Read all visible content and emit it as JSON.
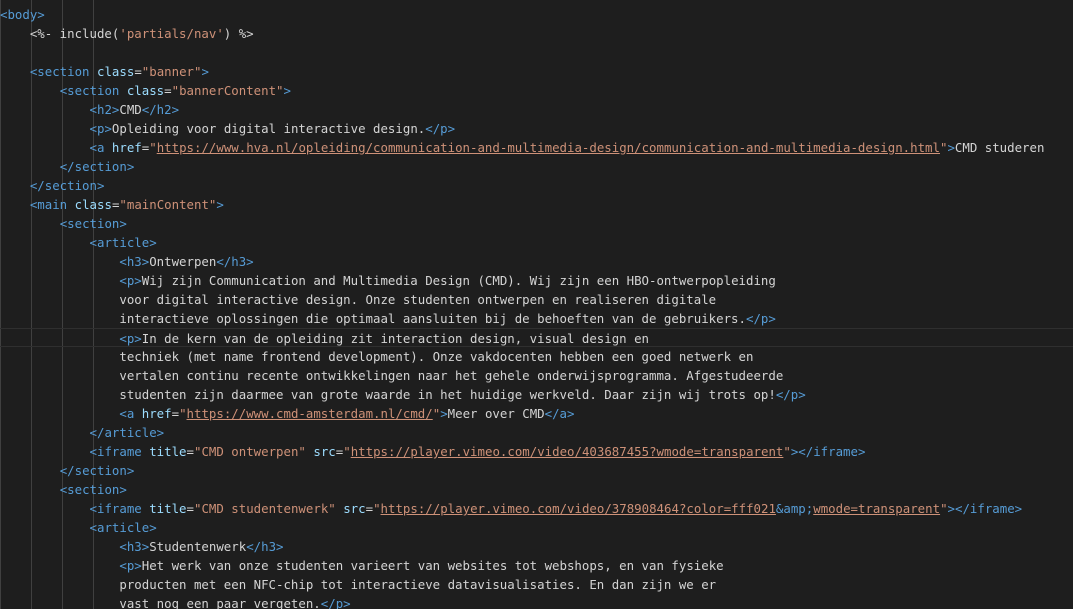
{
  "editor": {
    "theme_colors": {
      "background": "#1e1e1e",
      "tag": "#569cd6",
      "attribute": "#9cdcfe",
      "string": "#ce9178",
      "punctuation": "#808080",
      "text": "#d4d4d4",
      "indent_guide": "#404040"
    },
    "current_line": 17,
    "lines": [
      [
        [
          "t",
          "<body>"
        ]
      ],
      [
        [
          "x",
          "    <%- include("
        ],
        [
          "s",
          "'partials/nav'"
        ],
        [
          "x",
          ") %>"
        ]
      ],
      [],
      [
        [
          "x",
          "    "
        ],
        [
          "t",
          "<section"
        ],
        [
          "x",
          " "
        ],
        [
          "a",
          "class"
        ],
        [
          "x",
          "="
        ],
        [
          "s",
          "\"banner\""
        ],
        [
          "t",
          ">"
        ]
      ],
      [
        [
          "x",
          "        "
        ],
        [
          "t",
          "<section"
        ],
        [
          "x",
          " "
        ],
        [
          "a",
          "class"
        ],
        [
          "x",
          "="
        ],
        [
          "s",
          "\"bannerContent\""
        ],
        [
          "t",
          ">"
        ]
      ],
      [
        [
          "x",
          "            "
        ],
        [
          "t",
          "<h2>"
        ],
        [
          "x",
          "CMD"
        ],
        [
          "t",
          "</h2>"
        ]
      ],
      [
        [
          "x",
          "            "
        ],
        [
          "t",
          "<p>"
        ],
        [
          "x",
          "Opleiding voor digital interactive design."
        ],
        [
          "t",
          "</p>"
        ]
      ],
      [
        [
          "x",
          "            "
        ],
        [
          "t",
          "<a"
        ],
        [
          "x",
          " "
        ],
        [
          "a",
          "href"
        ],
        [
          "x",
          "="
        ],
        [
          "s",
          "\""
        ],
        [
          "u",
          "https://www.hva.nl/opleiding/communication-and-multimedia-design/communication-and-multimedia-design.html"
        ],
        [
          "s",
          "\""
        ],
        [
          "t",
          ">"
        ],
        [
          "x",
          "CMD studeren"
        ]
      ],
      [
        [
          "x",
          "        "
        ],
        [
          "t",
          "</section>"
        ]
      ],
      [
        [
          "x",
          "    "
        ],
        [
          "t",
          "</section>"
        ]
      ],
      [
        [
          "x",
          "    "
        ],
        [
          "t",
          "<main"
        ],
        [
          "x",
          " "
        ],
        [
          "a",
          "class"
        ],
        [
          "x",
          "="
        ],
        [
          "s",
          "\"mainContent\""
        ],
        [
          "t",
          ">"
        ]
      ],
      [
        [
          "x",
          "        "
        ],
        [
          "t",
          "<section>"
        ]
      ],
      [
        [
          "x",
          "            "
        ],
        [
          "t",
          "<article>"
        ]
      ],
      [
        [
          "x",
          "                "
        ],
        [
          "t",
          "<h3>"
        ],
        [
          "x",
          "Ontwerpen"
        ],
        [
          "t",
          "</h3>"
        ]
      ],
      [
        [
          "x",
          "                "
        ],
        [
          "t",
          "<p>"
        ],
        [
          "x",
          "Wij zijn Communication and Multimedia Design (CMD). Wij zijn een HBO-ontwerpopleiding"
        ]
      ],
      [
        [
          "x",
          "                voor digital interactive design. Onze studenten ontwerpen en realiseren digitale"
        ]
      ],
      [
        [
          "x",
          "                interactieve oplossingen die optimaal aansluiten bij de behoeften van de gebruikers."
        ],
        [
          "t",
          "</p>"
        ]
      ],
      [
        [
          "x",
          "                "
        ],
        [
          "t",
          "<p>"
        ],
        [
          "x",
          "In de kern van de opleiding zit interaction design, visual design en"
        ]
      ],
      [
        [
          "x",
          "                techniek (met name frontend development). Onze vakdocenten hebben een goed netwerk en"
        ]
      ],
      [
        [
          "x",
          "                vertalen continu recente ontwikkelingen naar het gehele onderwijsprogramma. Afgestudeerde"
        ]
      ],
      [
        [
          "x",
          "                studenten zijn daarmee van grote waarde in het huidige werkveld. Daar zijn wij trots op!"
        ],
        [
          "t",
          "</p>"
        ]
      ],
      [
        [
          "x",
          "                "
        ],
        [
          "t",
          "<a"
        ],
        [
          "x",
          " "
        ],
        [
          "a",
          "href"
        ],
        [
          "x",
          "="
        ],
        [
          "s",
          "\""
        ],
        [
          "u",
          "https://www.cmd-amsterdam.nl/cmd/"
        ],
        [
          "s",
          "\""
        ],
        [
          "t",
          ">"
        ],
        [
          "x",
          "Meer over CMD"
        ],
        [
          "t",
          "</a>"
        ]
      ],
      [
        [
          "x",
          "            "
        ],
        [
          "t",
          "</article>"
        ]
      ],
      [
        [
          "x",
          "            "
        ],
        [
          "t",
          "<iframe"
        ],
        [
          "x",
          " "
        ],
        [
          "a",
          "title"
        ],
        [
          "x",
          "="
        ],
        [
          "s",
          "\"CMD ontwerpen\""
        ],
        [
          "x",
          " "
        ],
        [
          "a",
          "src"
        ],
        [
          "x",
          "="
        ],
        [
          "s",
          "\""
        ],
        [
          "u",
          "https://player.vimeo.com/video/403687455?wmode=transparent"
        ],
        [
          "s",
          "\""
        ],
        [
          "t",
          "></iframe>"
        ]
      ],
      [
        [
          "x",
          "        "
        ],
        [
          "t",
          "</section>"
        ]
      ],
      [
        [
          "x",
          "        "
        ],
        [
          "t",
          "<section>"
        ]
      ],
      [
        [
          "x",
          "            "
        ],
        [
          "t",
          "<iframe"
        ],
        [
          "x",
          " "
        ],
        [
          "a",
          "title"
        ],
        [
          "x",
          "="
        ],
        [
          "s",
          "\"CMD studentenwerk\""
        ],
        [
          "x",
          " "
        ],
        [
          "a",
          "src"
        ],
        [
          "x",
          "="
        ],
        [
          "s",
          "\""
        ],
        [
          "u",
          "https://player.vimeo.com/video/378908464?color=fff021"
        ],
        [
          "t",
          "&amp;"
        ],
        [
          "u",
          "wmode=transparent"
        ],
        [
          "s",
          "\""
        ],
        [
          "t",
          "></iframe>"
        ]
      ],
      [
        [
          "x",
          "            "
        ],
        [
          "t",
          "<article>"
        ]
      ],
      [
        [
          "x",
          "                "
        ],
        [
          "t",
          "<h3>"
        ],
        [
          "x",
          "Studentenwerk"
        ],
        [
          "t",
          "</h3>"
        ]
      ],
      [
        [
          "x",
          "                "
        ],
        [
          "t",
          "<p>"
        ],
        [
          "x",
          "Het werk van onze studenten varieert van websites tot webshops, en van fysieke"
        ]
      ],
      [
        [
          "x",
          "                producten met een NFC-chip tot interactieve datavisualisaties. En dan zijn we er"
        ]
      ],
      [
        [
          "x",
          "                vast nog een paar vergeten."
        ],
        [
          "t",
          "</p>"
        ]
      ]
    ]
  }
}
